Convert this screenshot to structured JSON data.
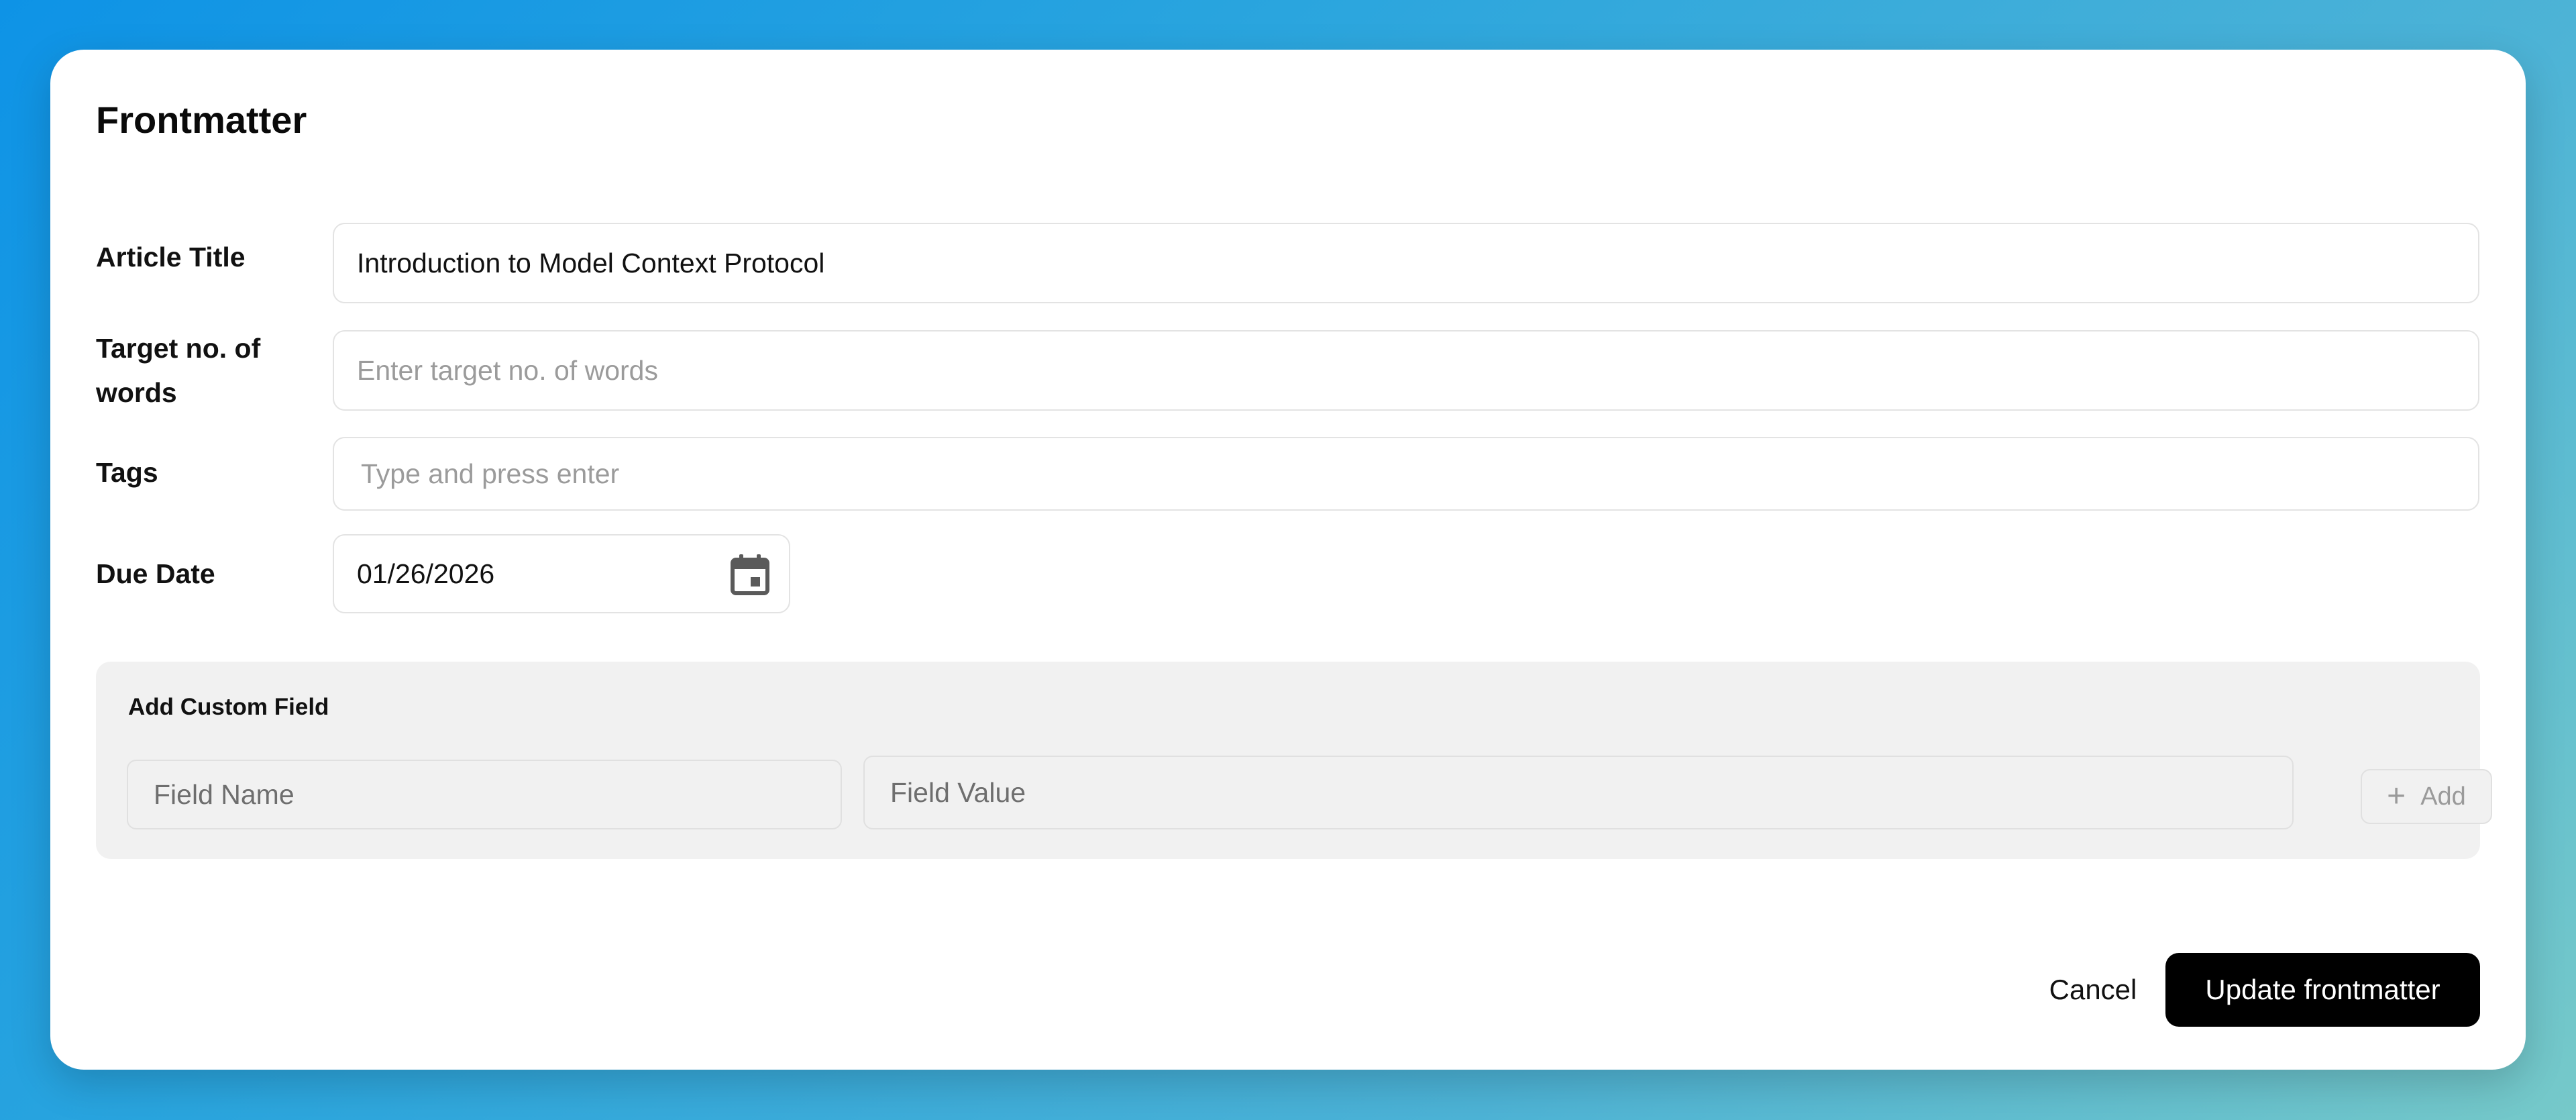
{
  "dialog": {
    "title": "Frontmatter"
  },
  "form": {
    "article_title": {
      "label": "Article Title",
      "value": "Introduction to Model Context Protocol"
    },
    "target_words": {
      "label": "Target no. of words",
      "value": "",
      "placeholder": "Enter target no. of words"
    },
    "tags": {
      "label": "Tags",
      "value": "",
      "placeholder": "Type and press enter"
    },
    "due_date": {
      "label": "Due Date",
      "value": "01/26/2026",
      "icon": "calendar-icon"
    }
  },
  "custom_field": {
    "title": "Add Custom Field",
    "name_placeholder": "Field Name",
    "value_placeholder": "Field Value",
    "add_label": "Add",
    "add_icon": "plus-icon"
  },
  "footer": {
    "cancel_label": "Cancel",
    "submit_label": "Update frontmatter"
  },
  "colors": {
    "primary_button": "#000000",
    "panel_background": "#f1f1f1",
    "background_gradient_start": "#0e93e6",
    "background_gradient_end": "#76c9c9"
  }
}
